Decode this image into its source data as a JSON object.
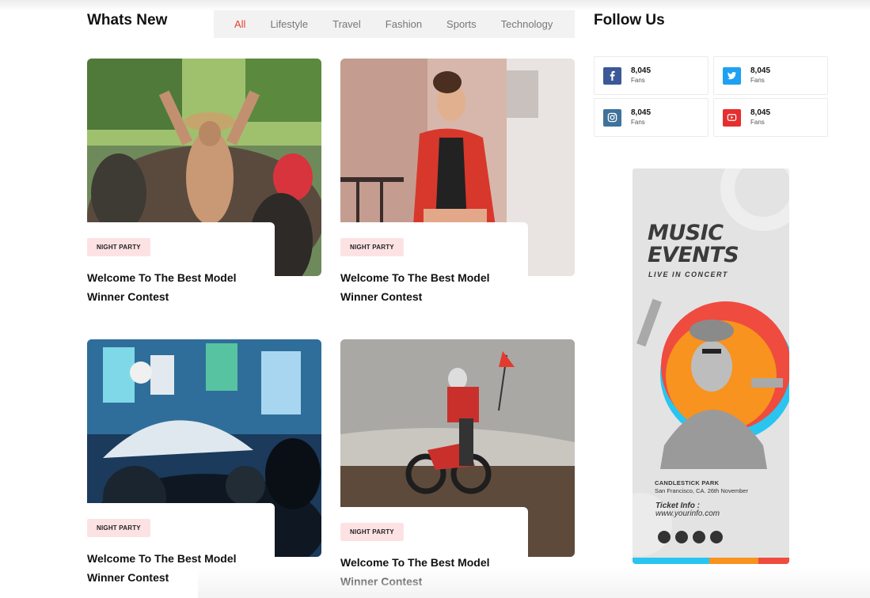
{
  "section": {
    "title": "Whats New"
  },
  "tabs": [
    "All",
    "Lifestyle",
    "Travel",
    "Fashion",
    "Sports",
    "Technology"
  ],
  "active_tab": "All",
  "cards": [
    {
      "badge": "NIGHT PARTY",
      "title": "Welcome To The Best Model Winner Contest",
      "image": "party-crowd-photo"
    },
    {
      "badge": "NIGHT PARTY",
      "title": "Welcome To The Best Model Winner Contest",
      "image": "woman-red-jacket-photo"
    },
    {
      "badge": "NIGHT PARTY",
      "title": "Welcome To The Best Model Winner Contest",
      "image": "night-city-umbrella-photo"
    },
    {
      "badge": "NIGHT PARTY",
      "title": "Welcome To The Best Model Winner Contest",
      "image": "dirt-bike-beach-photo"
    }
  ],
  "follow": {
    "title": "Follow Us",
    "items": [
      {
        "network": "facebook",
        "icon": "facebook-icon",
        "color": "#3b5998",
        "count": "8,045",
        "unit": "Fans"
      },
      {
        "network": "twitter",
        "icon": "twitter-icon",
        "color": "#1da1f2",
        "count": "8,045",
        "unit": "Fans"
      },
      {
        "network": "instagram",
        "icon": "instagram-icon",
        "color": "#3f729b",
        "count": "8,045",
        "unit": "Fans"
      },
      {
        "network": "youtube",
        "icon": "youtube-icon",
        "color": "#e62e2e",
        "count": "8,045",
        "unit": "Fans"
      }
    ]
  },
  "ad": {
    "line1": "MUSIC",
    "line2": "EVENTS",
    "line3": "LIVE IN CONCERT",
    "venue": "CANDLESTICK PARK",
    "address": "San Francisco, CA. 26th November",
    "ticket_label": "Ticket Info :",
    "ticket_url": "www.yourinfo.com",
    "colors": {
      "orange": "#f7931e",
      "red": "#ef4b3f",
      "blue": "#29c5f0"
    }
  }
}
